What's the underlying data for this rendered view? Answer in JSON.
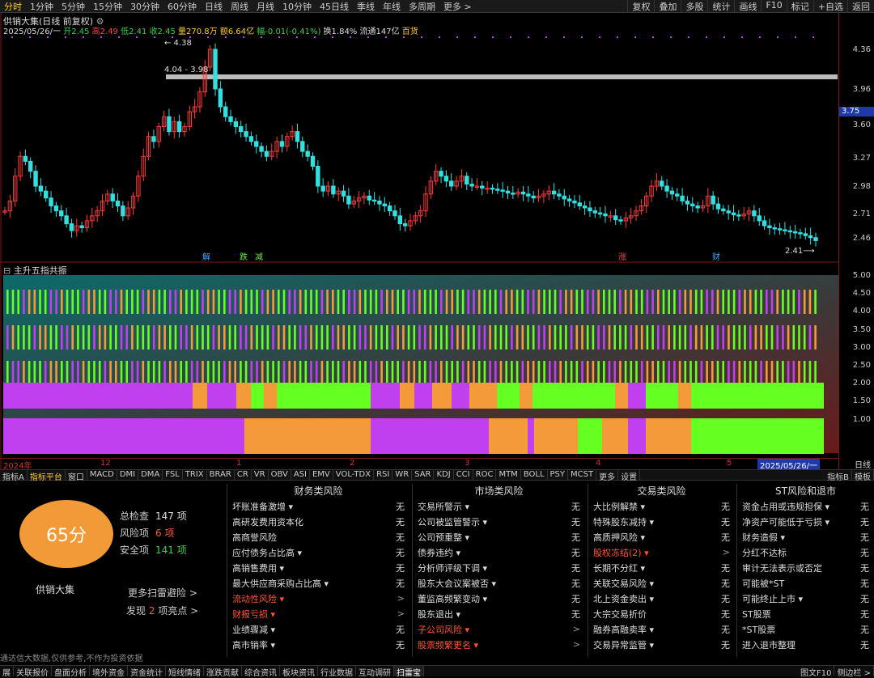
{
  "toolbar": {
    "timeframes": [
      "分时",
      "1分钟",
      "5分钟",
      "15分钟",
      "30分钟",
      "60分钟",
      "日线",
      "周线",
      "月线",
      "10分钟",
      "45日线",
      "季线",
      "年线",
      "多周期",
      "更多 >"
    ],
    "active": "分时",
    "right": [
      "复权",
      "叠加",
      "多股",
      "统计",
      "画线",
      "F10",
      "标记",
      "+自选",
      "返回"
    ]
  },
  "chart": {
    "title": "供销大集(日线 前复权)",
    "info_date": "2025/05/26/一",
    "open": "开2.45",
    "high": "高2.49",
    "low": "低2.41",
    "close": "收2.45",
    "volume": "量270.8万",
    "amount": "额6.64亿",
    "change": "幅-0.01(-0.41%)",
    "turnover": "换1.84%",
    "float_cap": "流通147亿",
    "sector": "百货",
    "annot_high": "4.38",
    "annot_range": "4.04 - 3.98",
    "annot_low": "2.41",
    "markers": [
      {
        "text": "解",
        "color": "#3fa7ff"
      },
      {
        "text": "跌",
        "color": "#6fe64d"
      },
      {
        "text": "减",
        "color": "#6fe64d"
      },
      {
        "text": "涨",
        "color": "#ff4444"
      },
      {
        "text": "财",
        "color": "#3fa7ff"
      }
    ],
    "price_labels": [
      "4.36",
      "3.96",
      "3.60",
      "3.27",
      "2.98",
      "2.71",
      "2.46"
    ],
    "current_price": "3.75",
    "sub_title": "主升五指共振",
    "sub_labels": [
      "5.00",
      "4.50",
      "4.00",
      "3.50",
      "3.00",
      "2.50",
      "2.00",
      "1.50",
      "1.00"
    ],
    "dates": [
      "2024年",
      "12",
      "1",
      "2",
      "3",
      "4",
      "5",
      "2025/05/26/一"
    ],
    "period": "日线",
    "colors": {
      "up": "#ff3b3b",
      "down": "#33e0e0",
      "purple": "#c040f0",
      "green": "#66ff22",
      "orange": "#f59a3a"
    }
  },
  "chart_data": {
    "type": "candlestick",
    "title": "供销大集(日线 前复权)",
    "ylim": [
      2.38,
      4.42
    ],
    "closes": [
      2.75,
      2.85,
      3.1,
      3.3,
      3.25,
      3.15,
      3.0,
      2.95,
      2.88,
      2.8,
      2.75,
      2.7,
      2.62,
      2.55,
      2.6,
      2.58,
      2.65,
      2.7,
      2.75,
      2.85,
      2.92,
      2.85,
      2.8,
      2.7,
      2.78,
      2.9,
      3.1,
      3.3,
      3.5,
      3.45,
      3.6,
      3.7,
      3.55,
      3.65,
      3.55,
      3.6,
      3.75,
      3.8,
      3.95,
      4.2,
      4.38,
      3.98,
      3.8,
      3.7,
      3.65,
      3.6,
      3.55,
      3.5,
      3.45,
      3.4,
      3.35,
      3.3,
      3.35,
      3.45,
      3.4,
      3.5,
      3.55,
      3.45,
      3.35,
      3.3,
      3.2,
      3.0,
      2.95,
      3.0,
      2.92,
      2.95,
      2.9,
      2.82,
      2.85,
      2.88,
      2.9,
      2.86,
      2.85,
      2.82,
      2.8,
      2.75,
      2.7,
      2.62,
      2.6,
      2.65,
      2.7,
      2.75,
      2.92,
      3.05,
      3.15,
      3.1,
      3.05,
      3.0,
      3.05,
      3.1,
      3.02,
      3.0,
      3.0,
      2.98,
      2.98,
      2.97,
      2.96,
      2.95,
      2.93,
      2.92,
      2.94,
      2.92,
      2.9,
      2.88,
      2.9,
      2.92,
      2.95,
      2.92,
      2.9,
      2.87,
      2.85,
      2.83,
      2.8,
      2.78,
      2.75,
      2.73,
      2.72,
      2.7,
      2.7,
      2.66,
      2.65,
      2.68,
      2.7,
      2.75,
      2.8,
      2.9,
      3.0,
      3.05,
      3.0,
      2.95,
      2.92,
      2.9,
      2.85,
      2.82,
      2.8,
      2.78,
      2.8,
      2.9,
      2.82,
      2.77,
      2.75,
      2.73,
      2.71,
      2.7,
      2.72,
      2.75,
      2.7,
      2.65,
      2.6,
      2.58,
      2.57,
      2.56,
      2.55,
      2.54,
      2.53,
      2.52,
      2.5,
      2.48,
      2.45
    ]
  },
  "score": {
    "value": "65分",
    "company": "供销大集"
  },
  "stats": [
    {
      "label": "总检查",
      "value": "147 项",
      "color": "#ddd"
    },
    {
      "label": "风险项",
      "value": "6 项",
      "color": "#ff5533"
    },
    {
      "label": "安全项",
      "value": "141 项",
      "color": "#3fd04a"
    }
  ],
  "more": {
    "label": "更多扫雷避险 >",
    "find_prefix": "发现",
    "find_count": "2",
    "find_suffix": "项亮点 >"
  },
  "disclaimer": "通达信大数据,仅供参考,不作为投资依据",
  "columns": [
    {
      "title": "财务类风险",
      "rows": [
        {
          "label": "坏账准备激增 ▾",
          "val": "无",
          "red": false
        },
        {
          "label": "高研发费用资本化",
          "val": "无",
          "red": false
        },
        {
          "label": "高商誉风险",
          "val": "无",
          "red": false
        },
        {
          "label": "应付债务占比高 ▾",
          "val": "无",
          "red": false
        },
        {
          "label": "高销售费用 ▾",
          "val": "无",
          "red": false
        },
        {
          "label": "最大供应商采购占比高 ▾",
          "val": "无",
          "red": false
        },
        {
          "label": "流动性风险 ▾",
          "val": ">",
          "red": true
        },
        {
          "label": "财报亏损 ▾",
          "val": ">",
          "red": true
        },
        {
          "label": "业绩骤减 ▾",
          "val": "无",
          "red": false
        },
        {
          "label": "高市销率 ▾",
          "val": "无",
          "red": false
        }
      ]
    },
    {
      "title": "市场类风险",
      "rows": [
        {
          "label": "交易所警示 ▾",
          "val": "无",
          "red": false
        },
        {
          "label": "公司被监管警示 ▾",
          "val": "无",
          "red": false
        },
        {
          "label": "公司预重整 ▾",
          "val": "无",
          "red": false
        },
        {
          "label": "债券违约 ▾",
          "val": "无",
          "red": false
        },
        {
          "label": "分析师评级下调 ▾",
          "val": "无",
          "red": false
        },
        {
          "label": "股东大会议案被否 ▾",
          "val": "无",
          "red": false
        },
        {
          "label": "董监高频繁变动 ▾",
          "val": "无",
          "red": false
        },
        {
          "label": "股东退出 ▾",
          "val": "无",
          "red": false
        },
        {
          "label": "子公司风险 ▾",
          "val": ">",
          "red": true
        },
        {
          "label": "股票频繁更名 ▾",
          "val": ">",
          "red": true
        }
      ]
    },
    {
      "title": "交易类风险",
      "rows": [
        {
          "label": "大比例解禁 ▾",
          "val": "无",
          "red": false
        },
        {
          "label": "特殊股东减持 ▾",
          "val": "无",
          "red": false
        },
        {
          "label": "高质押风险 ▾",
          "val": "无",
          "red": false
        },
        {
          "label": "股权冻结(2) ▾",
          "val": ">",
          "red": true
        },
        {
          "label": "长期不分红 ▾",
          "val": "无",
          "red": false
        },
        {
          "label": "关联交易风险 ▾",
          "val": "无",
          "red": false
        },
        {
          "label": "北上资金卖出 ▾",
          "val": "无",
          "red": false
        },
        {
          "label": "大宗交易折价",
          "val": "无",
          "red": false
        },
        {
          "label": "融券高融卖率 ▾",
          "val": "无",
          "red": false
        },
        {
          "label": "交易异常监管 ▾",
          "val": "无",
          "red": false
        }
      ]
    },
    {
      "title": "ST风险和退市",
      "rows": [
        {
          "label": "资金占用或违规担保 ▾",
          "val": "无",
          "red": false
        },
        {
          "label": "净资产可能低于亏损 ▾",
          "val": "无",
          "red": false
        },
        {
          "label": "财务造假 ▾",
          "val": "无",
          "red": false
        },
        {
          "label": "分红不达标",
          "val": "无",
          "red": false
        },
        {
          "label": "审计无法表示或否定",
          "val": "无",
          "red": false
        },
        {
          "label": "可能被*ST",
          "val": "无",
          "red": false
        },
        {
          "label": "可能终止上市 ▾",
          "val": "无",
          "red": false
        },
        {
          "label": "ST股票",
          "val": "无",
          "red": false
        },
        {
          "label": "*ST股票",
          "val": "无",
          "red": false
        },
        {
          "label": "进入退市整理",
          "val": "无",
          "red": false
        }
      ]
    }
  ],
  "indicator_tabs": [
    "指标A",
    "指标平台",
    "窗口",
    "MACD",
    "DMI",
    "DMA",
    "FSL",
    "TRIX",
    "BRAR",
    "CR",
    "VR",
    "OBV",
    "ASI",
    "EMV",
    "VOL-TDX",
    "RSI",
    "WR",
    "SAR",
    "KDJ",
    "CCI",
    "ROC",
    "MTM",
    "BOLL",
    "PSY",
    "MCST",
    "更多",
    "设置"
  ],
  "indicator_tabs_right": [
    "指标B",
    "模板"
  ],
  "bottom_tabs": [
    "展",
    "关联报价",
    "盘面分析",
    "境外资金",
    "资金统计",
    "短线情绪",
    "涨跌贡献",
    "综合资讯",
    "板块资讯",
    "行业数据",
    "互动调研",
    "扫雷宝"
  ],
  "bottom_tabs_right": [
    "图文F10",
    "侧边栏 >"
  ]
}
